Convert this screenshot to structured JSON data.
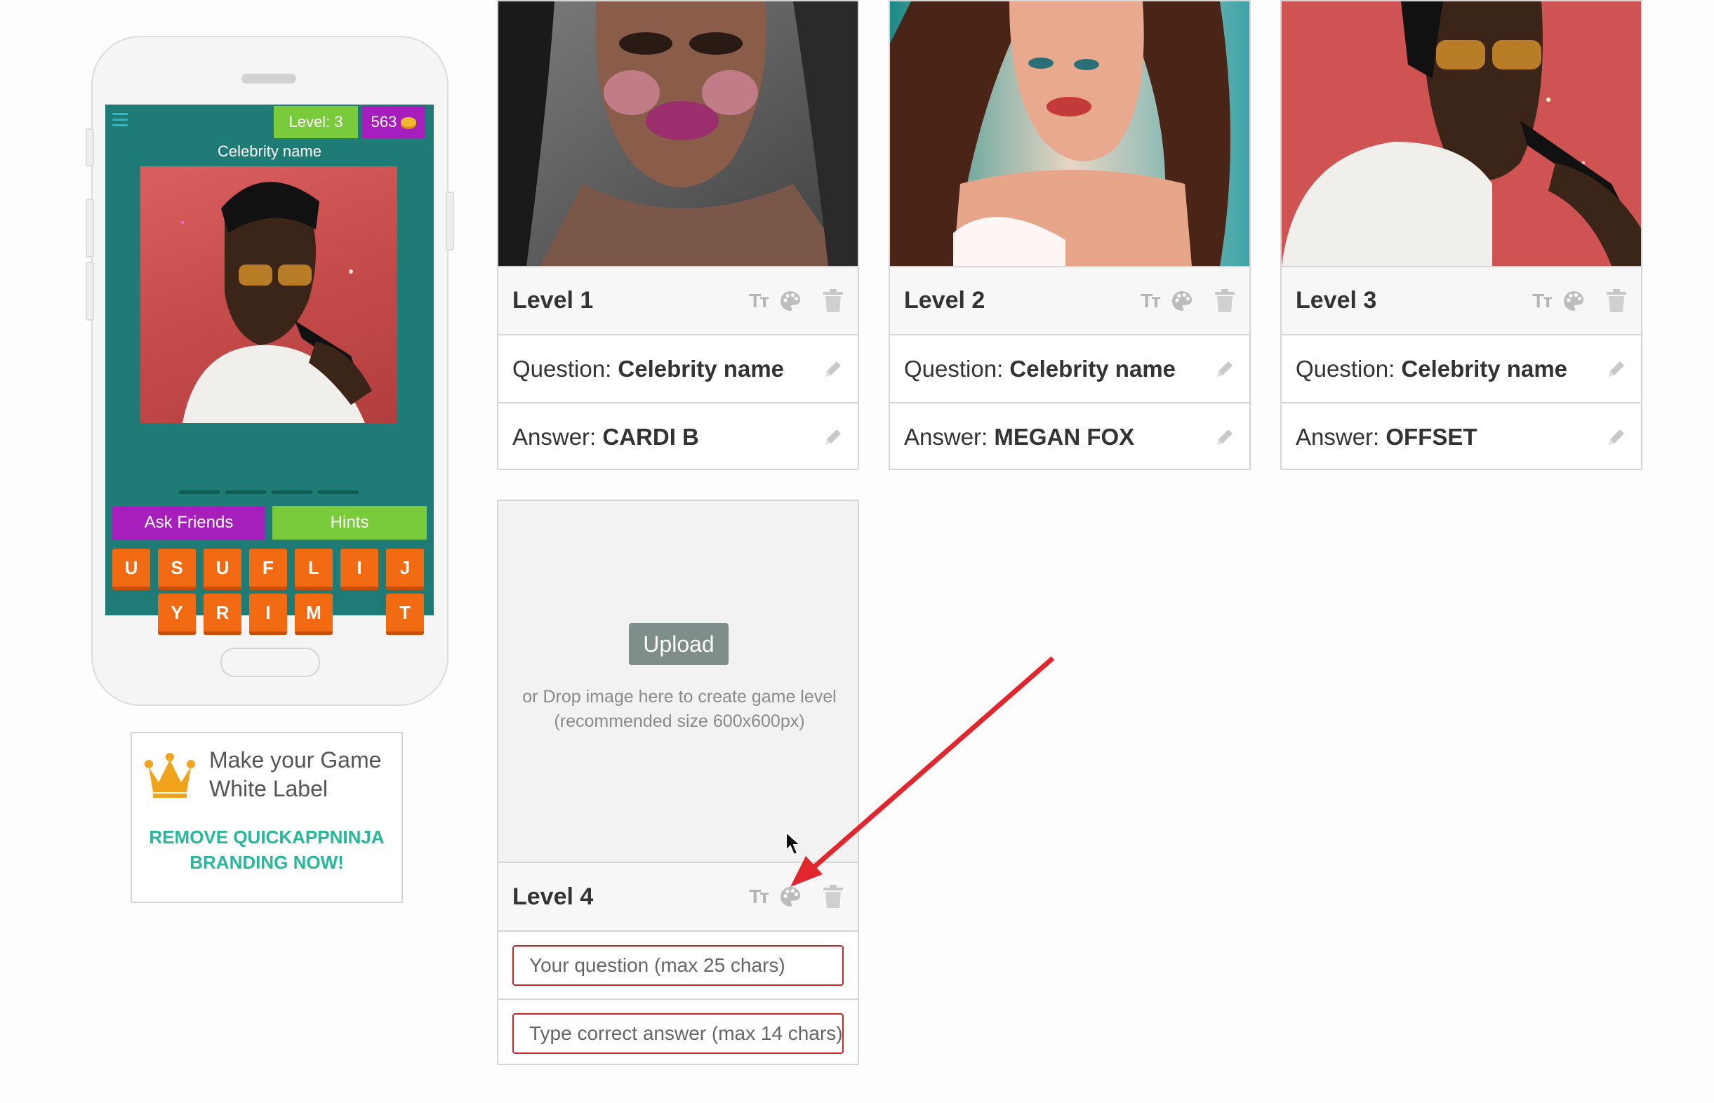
{
  "phone_preview": {
    "level_badge": "Level: 3",
    "coins": "563",
    "question_title": "Celebrity name",
    "ask_friends_label": "Ask Friends",
    "hints_label": "Hints",
    "letters_row1": [
      "U",
      "S",
      "U",
      "F",
      "L",
      "I",
      "J"
    ],
    "letters_row2": [
      "Y",
      "R",
      "I",
      "M",
      "",
      "T"
    ]
  },
  "promo": {
    "title_line1": "Make your Game",
    "title_line2": "White Label",
    "cta_line1": "REMOVE QUICKAPPNINJA",
    "cta_line2": "BRANDING NOW!"
  },
  "levels": [
    {
      "title": "Level 1",
      "question_label": "Question:",
      "question": "Celebrity name",
      "answer_label": "Answer:",
      "answer": "CARDI B"
    },
    {
      "title": "Level 2",
      "question_label": "Question:",
      "question": "Celebrity name",
      "answer_label": "Answer:",
      "answer": "MEGAN FOX"
    },
    {
      "title": "Level 3",
      "question_label": "Question:",
      "question": "Celebrity name",
      "answer_label": "Answer:",
      "answer": "OFFSET"
    }
  ],
  "new_level": {
    "upload_label": "Upload",
    "drop_line1": "or Drop image here to create game level",
    "drop_line2": "(recommended size 600x600px)",
    "title": "Level 4",
    "question_placeholder": "Your question (max 25 chars)",
    "answer_placeholder": "Type correct answer (max 14 chars)"
  },
  "icons": {
    "text_style": "Tт",
    "palette": "palette-icon",
    "trash": "trash-icon",
    "pencil": "✎",
    "crown": "crown-icon",
    "menu": "hamburger-icon"
  },
  "colors": {
    "game_bg": "#1f7b76",
    "purple": "#a61ebc",
    "green": "#7acb3b",
    "tile_orange": "#f26b12",
    "accent_teal": "#27b89a",
    "annotation_red": "#e3262d"
  }
}
